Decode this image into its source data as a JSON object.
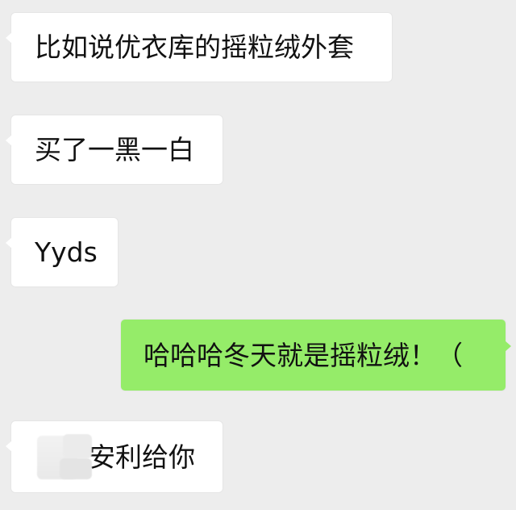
{
  "chat": {
    "messages": [
      {
        "text": "比如说优衣库的摇粒绒外套",
        "sender": "other"
      },
      {
        "text": "买了一黑一白",
        "sender": "other"
      },
      {
        "text": "Yyds",
        "sender": "other"
      },
      {
        "text": "哈哈哈冬天就是摇粒绒！（",
        "sender": "me"
      },
      {
        "text": "安利给你",
        "sender": "other"
      }
    ]
  },
  "colors": {
    "background": "#ededed",
    "incoming_bubble": "#ffffff",
    "outgoing_bubble": "#95ec69",
    "text": "#111111"
  }
}
